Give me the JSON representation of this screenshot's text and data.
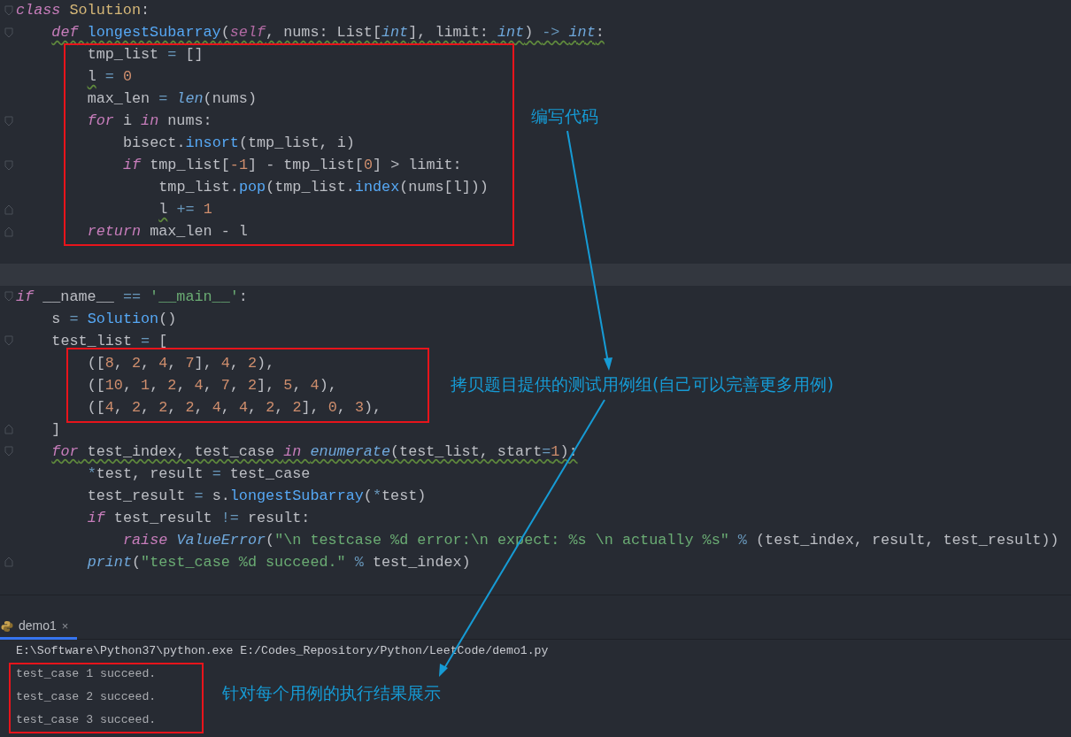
{
  "editor": {
    "lines": [
      {
        "kind": "code",
        "fold_start": true,
        "tokens": [
          {
            "kind": "keyword",
            "text": "class "
          },
          {
            "kind": "class_name",
            "text": "Solution"
          },
          {
            "kind": "plain",
            "text": ":"
          }
        ],
        "children": [
          {
            "kind": "code",
            "fold_start": true,
            "warn": true,
            "tokens": [
              {
                "kind": "keyword",
                "text": "def "
              },
              {
                "kind": "function",
                "text": "longestSubarray"
              },
              {
                "kind": "plain",
                "text": "("
              },
              {
                "kind": "self",
                "text": "self"
              },
              {
                "kind": "plain",
                "text": ", nums: List["
              },
              {
                "kind": "builtin",
                "text": "int"
              },
              {
                "kind": "plain",
                "text": "], limit: "
              },
              {
                "kind": "builtin",
                "text": "int"
              },
              {
                "kind": "plain",
                "text": ") "
              },
              {
                "kind": "operator",
                "text": "-> "
              },
              {
                "kind": "builtin",
                "text": "int"
              },
              {
                "kind": "plain",
                "text": ":"
              }
            ],
            "children": [
              {
                "kind": "code",
                "tokens": [
                  {
                    "kind": "plain",
                    "text": "tmp_list "
                  },
                  {
                    "kind": "operator",
                    "text": "="
                  },
                  {
                    "kind": "plain",
                    "text": " []"
                  }
                ]
              },
              {
                "kind": "code",
                "tokens": [
                  {
                    "kind": "plain",
                    "text": "l",
                    "warn": true
                  },
                  {
                    "kind": "operator",
                    "text": " = "
                  },
                  {
                    "kind": "number",
                    "text": "0"
                  }
                ]
              },
              {
                "kind": "code",
                "tokens": [
                  {
                    "kind": "plain",
                    "text": "max_len "
                  },
                  {
                    "kind": "operator",
                    "text": "= "
                  },
                  {
                    "kind": "builtin",
                    "text": "len"
                  },
                  {
                    "kind": "plain",
                    "text": "(nums)"
                  }
                ]
              },
              {
                "kind": "code",
                "fold_start": true,
                "tokens": [
                  {
                    "kind": "keyword",
                    "text": "for"
                  },
                  {
                    "kind": "plain",
                    "text": " i "
                  },
                  {
                    "kind": "keyword",
                    "text": "in"
                  },
                  {
                    "kind": "plain",
                    "text": " nums:"
                  }
                ],
                "children": [
                  {
                    "kind": "code",
                    "tokens": [
                      {
                        "kind": "plain",
                        "text": "bisect."
                      },
                      {
                        "kind": "call",
                        "text": "insort"
                      },
                      {
                        "kind": "plain",
                        "text": "(tmp_list, i)"
                      }
                    ]
                  },
                  {
                    "kind": "code",
                    "fold_start": true,
                    "tokens": [
                      {
                        "kind": "keyword",
                        "text": "if"
                      },
                      {
                        "kind": "plain",
                        "text": " tmp_list["
                      },
                      {
                        "kind": "number",
                        "text": "-1"
                      },
                      {
                        "kind": "plain",
                        "text": "] - tmp_list["
                      },
                      {
                        "kind": "number",
                        "text": "0"
                      },
                      {
                        "kind": "plain",
                        "text": "] > limit:"
                      }
                    ],
                    "children": [
                      {
                        "kind": "code",
                        "tokens": [
                          {
                            "kind": "plain",
                            "text": "tmp_list."
                          },
                          {
                            "kind": "call",
                            "text": "pop"
                          },
                          {
                            "kind": "plain",
                            "text": "(tmp_list."
                          },
                          {
                            "kind": "call",
                            "text": "index"
                          },
                          {
                            "kind": "plain",
                            "text": "(nums[l]))"
                          }
                        ]
                      },
                      {
                        "kind": "code",
                        "fold_end": true,
                        "tokens": [
                          {
                            "kind": "plain",
                            "text": "l",
                            "warn": true
                          },
                          {
                            "kind": "operator",
                            "text": " += "
                          },
                          {
                            "kind": "number",
                            "text": "1"
                          }
                        ]
                      }
                    ]
                  }
                ]
              },
              {
                "kind": "code",
                "fold_end": true,
                "tokens": [
                  {
                    "kind": "keyword",
                    "text": "return"
                  },
                  {
                    "kind": "plain",
                    "text": " max_len - l"
                  }
                ]
              }
            ]
          }
        ]
      },
      {
        "kind": "blank"
      },
      {
        "kind": "blank",
        "current": true
      },
      {
        "kind": "code",
        "fold_start": true,
        "tokens": [
          {
            "kind": "keyword",
            "text": "if"
          },
          {
            "kind": "plain",
            "text": " __name__ "
          },
          {
            "kind": "operator",
            "text": "== "
          },
          {
            "kind": "string",
            "text": "'__main__'"
          },
          {
            "kind": "plain",
            "text": ":"
          }
        ],
        "children": [
          {
            "kind": "code",
            "tokens": [
              {
                "kind": "plain",
                "text": "s "
              },
              {
                "kind": "operator",
                "text": "= "
              },
              {
                "kind": "call",
                "text": "Solution"
              },
              {
                "kind": "plain",
                "text": "()"
              }
            ]
          },
          {
            "kind": "code",
            "fold_start": true,
            "tokens": [
              {
                "kind": "plain",
                "text": "test_list "
              },
              {
                "kind": "operator",
                "text": "="
              },
              {
                "kind": "plain",
                "text": " ["
              }
            ],
            "children": [
              {
                "kind": "code",
                "tokens": [
                  {
                    "kind": "plain",
                    "text": "(["
                  },
                  {
                    "kind": "number",
                    "text": "8"
                  },
                  {
                    "kind": "plain",
                    "text": ", "
                  },
                  {
                    "kind": "number",
                    "text": "2"
                  },
                  {
                    "kind": "plain",
                    "text": ", "
                  },
                  {
                    "kind": "number",
                    "text": "4"
                  },
                  {
                    "kind": "plain",
                    "text": ", "
                  },
                  {
                    "kind": "number",
                    "text": "7"
                  },
                  {
                    "kind": "plain",
                    "text": "], "
                  },
                  {
                    "kind": "number",
                    "text": "4"
                  },
                  {
                    "kind": "plain",
                    "text": ", "
                  },
                  {
                    "kind": "number",
                    "text": "2"
                  },
                  {
                    "kind": "plain",
                    "text": "),"
                  }
                ]
              },
              {
                "kind": "code",
                "tokens": [
                  {
                    "kind": "plain",
                    "text": "(["
                  },
                  {
                    "kind": "number",
                    "text": "10"
                  },
                  {
                    "kind": "plain",
                    "text": ", "
                  },
                  {
                    "kind": "number",
                    "text": "1"
                  },
                  {
                    "kind": "plain",
                    "text": ", "
                  },
                  {
                    "kind": "number",
                    "text": "2"
                  },
                  {
                    "kind": "plain",
                    "text": ", "
                  },
                  {
                    "kind": "number",
                    "text": "4"
                  },
                  {
                    "kind": "plain",
                    "text": ", "
                  },
                  {
                    "kind": "number",
                    "text": "7"
                  },
                  {
                    "kind": "plain",
                    "text": ", "
                  },
                  {
                    "kind": "number",
                    "text": "2"
                  },
                  {
                    "kind": "plain",
                    "text": "], "
                  },
                  {
                    "kind": "number",
                    "text": "5"
                  },
                  {
                    "kind": "plain",
                    "text": ", "
                  },
                  {
                    "kind": "number",
                    "text": "4"
                  },
                  {
                    "kind": "plain",
                    "text": "),"
                  }
                ]
              },
              {
                "kind": "code",
                "tokens": [
                  {
                    "kind": "plain",
                    "text": "(["
                  },
                  {
                    "kind": "number",
                    "text": "4"
                  },
                  {
                    "kind": "plain",
                    "text": ", "
                  },
                  {
                    "kind": "number",
                    "text": "2"
                  },
                  {
                    "kind": "plain",
                    "text": ", "
                  },
                  {
                    "kind": "number",
                    "text": "2"
                  },
                  {
                    "kind": "plain",
                    "text": ", "
                  },
                  {
                    "kind": "number",
                    "text": "2"
                  },
                  {
                    "kind": "plain",
                    "text": ", "
                  },
                  {
                    "kind": "number",
                    "text": "4"
                  },
                  {
                    "kind": "plain",
                    "text": ", "
                  },
                  {
                    "kind": "number",
                    "text": "4"
                  },
                  {
                    "kind": "plain",
                    "text": ", "
                  },
                  {
                    "kind": "number",
                    "text": "2"
                  },
                  {
                    "kind": "plain",
                    "text": ", "
                  },
                  {
                    "kind": "number",
                    "text": "2"
                  },
                  {
                    "kind": "plain",
                    "text": "], "
                  },
                  {
                    "kind": "number",
                    "text": "0"
                  },
                  {
                    "kind": "plain",
                    "text": ", "
                  },
                  {
                    "kind": "number",
                    "text": "3"
                  },
                  {
                    "kind": "plain",
                    "text": "),"
                  }
                ]
              }
            ]
          },
          {
            "kind": "code",
            "fold_end": true,
            "tokens": [
              {
                "kind": "plain",
                "text": "]"
              }
            ]
          },
          {
            "kind": "code",
            "fold_start": true,
            "warn": true,
            "tokens": [
              {
                "kind": "keyword",
                "text": "for"
              },
              {
                "kind": "plain",
                "text": " test_index, test_case "
              },
              {
                "kind": "keyword",
                "text": "in "
              },
              {
                "kind": "builtin",
                "text": "enumerate"
              },
              {
                "kind": "plain",
                "text": "(test_list, start"
              },
              {
                "kind": "operator",
                "text": "="
              },
              {
                "kind": "number",
                "text": "1"
              },
              {
                "kind": "plain",
                "text": "):"
              }
            ],
            "children": [
              {
                "kind": "code",
                "tokens": [
                  {
                    "kind": "operator",
                    "text": "*"
                  },
                  {
                    "kind": "plain",
                    "text": "test, result "
                  },
                  {
                    "kind": "operator",
                    "text": "="
                  },
                  {
                    "kind": "plain",
                    "text": " test_case"
                  }
                ]
              },
              {
                "kind": "code",
                "tokens": [
                  {
                    "kind": "plain",
                    "text": "test_result "
                  },
                  {
                    "kind": "operator",
                    "text": "="
                  },
                  {
                    "kind": "plain",
                    "text": " s."
                  },
                  {
                    "kind": "call",
                    "text": "longestSubarray"
                  },
                  {
                    "kind": "plain",
                    "text": "("
                  },
                  {
                    "kind": "operator",
                    "text": "*"
                  },
                  {
                    "kind": "plain",
                    "text": "test)"
                  }
                ]
              },
              {
                "kind": "code",
                "tokens": [
                  {
                    "kind": "keyword",
                    "text": "if"
                  },
                  {
                    "kind": "plain",
                    "text": " test_result "
                  },
                  {
                    "kind": "operator",
                    "text": "!="
                  },
                  {
                    "kind": "plain",
                    "text": " result:"
                  }
                ],
                "children": [
                  {
                    "kind": "code",
                    "tokens": [
                      {
                        "kind": "keyword",
                        "text": "raise "
                      },
                      {
                        "kind": "builtin",
                        "text": "ValueError"
                      },
                      {
                        "kind": "plain",
                        "text": "("
                      },
                      {
                        "kind": "string",
                        "text": "\"\\n testcase %d error:\\n expect: %s \\n actually %s\""
                      },
                      {
                        "kind": "operator",
                        "text": " % "
                      },
                      {
                        "kind": "plain",
                        "text": "(test_index, result, test_result))"
                      }
                    ]
                  }
                ]
              },
              {
                "kind": "code",
                "fold_end": true,
                "tokens": [
                  {
                    "kind": "builtin",
                    "text": "print"
                  },
                  {
                    "kind": "plain",
                    "text": "("
                  },
                  {
                    "kind": "string",
                    "text": "\"test_case %d succeed.\""
                  },
                  {
                    "kind": "operator",
                    "text": " % "
                  },
                  {
                    "kind": "plain",
                    "text": "test_index)"
                  }
                ]
              }
            ]
          }
        ]
      },
      {
        "kind": "blank"
      }
    ]
  },
  "run_panel": {
    "tab": {
      "label": "demo1",
      "close": "×",
      "selected": true
    },
    "lines": [
      "E:\\Software\\Python37\\python.exe E:/Codes_Repository/Python/LeetCode/demo1.py",
      "test_case 1 succeed.",
      "test_case 2 succeed.",
      "test_case 3 succeed."
    ]
  },
  "annotations": [
    {
      "text": "编写代码"
    },
    {
      "text": "拷贝题目提供的测试用例组(自己可以完善更多用例)"
    },
    {
      "text": "针对每个用例的执行结果展示"
    }
  ]
}
